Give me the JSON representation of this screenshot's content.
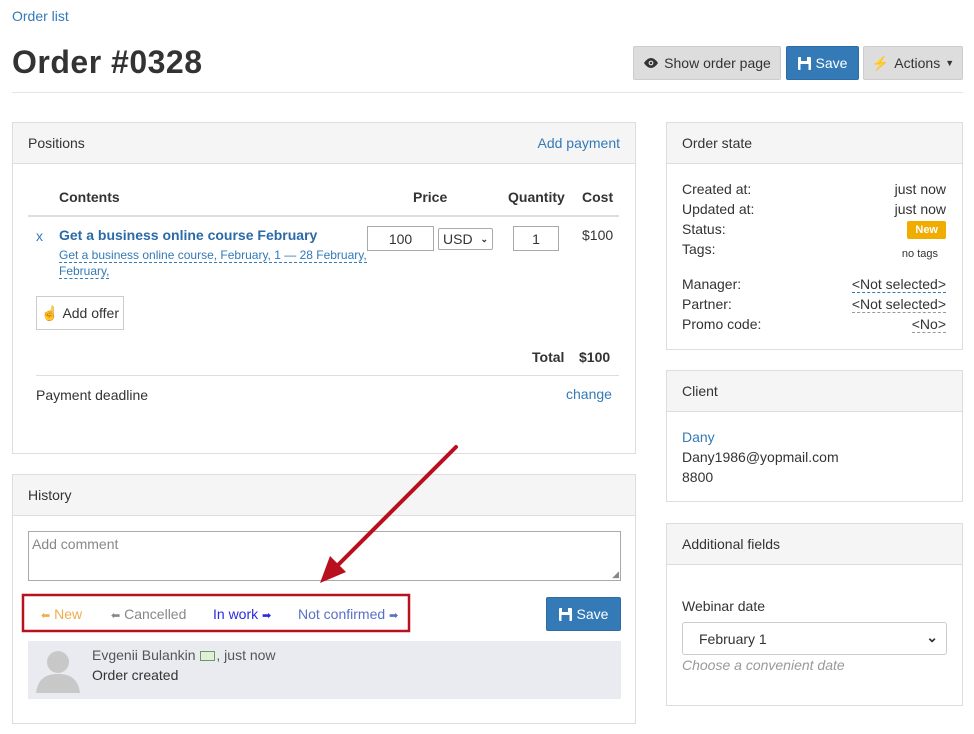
{
  "breadcrumb": "Order list",
  "page_title": "Order #0328",
  "toolbar": {
    "show_order_page": "Show order page",
    "save": "Save",
    "actions": "Actions"
  },
  "positions": {
    "title": "Positions",
    "add_payment": "Add payment",
    "columns": {
      "contents": "Contents",
      "price": "Price",
      "quantity": "Quantity",
      "cost": "Cost"
    },
    "items": [
      {
        "remove": "x",
        "name": "Get a business online course February",
        "desc_line1": "Get a business online course, February, 1 — 28 February,",
        "desc_line2": "February,",
        "price": "100",
        "currency": "USD",
        "quantity": "1",
        "cost": "$100"
      }
    ],
    "add_offer": "Add offer",
    "total_label": "Total",
    "total_value": "$100",
    "payment_deadline": "Payment deadline",
    "change": "change"
  },
  "history": {
    "title": "History",
    "comment_placeholder": "Add comment",
    "statuses": [
      {
        "label": "New",
        "color": "#f0ad4e",
        "arrow": "left"
      },
      {
        "label": "Cancelled",
        "color": "#888888",
        "arrow": "left"
      },
      {
        "label": "In work",
        "color": "#2a2adf",
        "arrow": "right"
      },
      {
        "label": "Not confirmed",
        "color": "#5a6fc4",
        "arrow": "right"
      }
    ],
    "save": "Save",
    "entry": {
      "author": "Evgenii Bulankin",
      "time": ", just now",
      "text": "Order created"
    }
  },
  "order_state": {
    "title": "Order state",
    "created_label": "Created at:",
    "created_value": "just now",
    "updated_label": "Updated at:",
    "updated_value": "just now",
    "status_label": "Status:",
    "status_value": "New",
    "tags_label": "Tags:",
    "tags_value": "no tags",
    "manager_label": "Manager:",
    "manager_value": "<Not selected>",
    "partner_label": "Partner:",
    "partner_value": "<Not selected>",
    "promo_label": "Promo code:",
    "promo_value": "<No>"
  },
  "client": {
    "title": "Client",
    "name": "Dany",
    "email": "Dany1986@yopmail.com",
    "phone": "8800"
  },
  "additional": {
    "title": "Additional fields",
    "webinar_label": "Webinar date",
    "webinar_value": "February 1",
    "webinar_hint": "Choose a convenient date"
  },
  "colors": {
    "primary": "#337ab7",
    "annotation": "#b8101f",
    "status_new": "#f0ad00"
  }
}
